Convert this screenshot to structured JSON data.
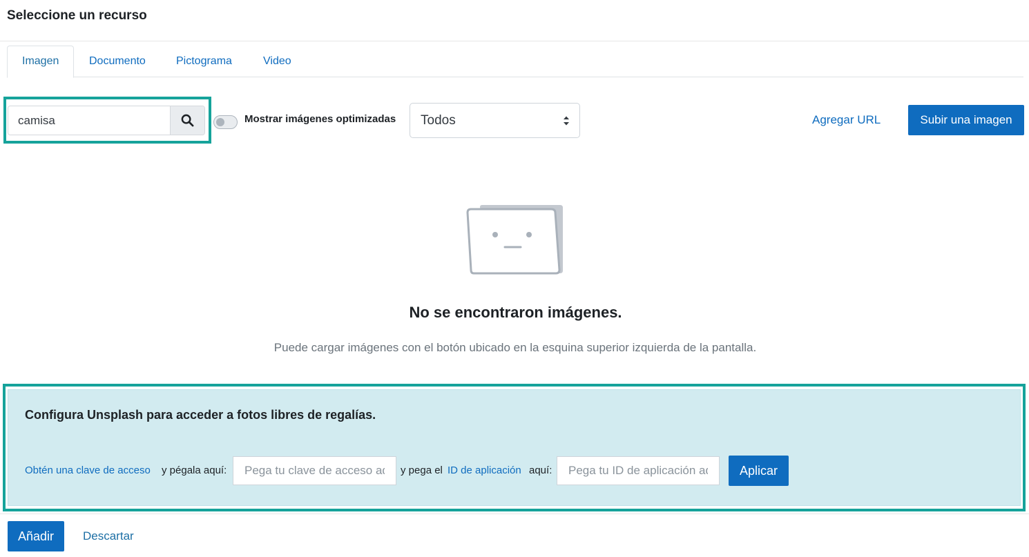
{
  "dialog": {
    "title": "Seleccione un recurso"
  },
  "tabs": [
    {
      "label": "Imagen",
      "active": true
    },
    {
      "label": "Documento",
      "active": false
    },
    {
      "label": "Pictograma",
      "active": false
    },
    {
      "label": "Video",
      "active": false
    }
  ],
  "toolbar": {
    "search_value": "camisa",
    "toggle_label": "Mostrar imágenes optimizadas",
    "toggle_on": false,
    "filter_selected": "Todos",
    "add_url_label": "Agregar URL",
    "upload_label": "Subir una imagen"
  },
  "empty_state": {
    "title": "No se encontraron imágenes.",
    "message": "Puede cargar imágenes con el botón ubicado en la esquina superior izquierda de la pantalla."
  },
  "unsplash": {
    "title": "Configura Unsplash para acceder a fotos libres de regalías.",
    "access_key_link": "Obtén una clave de acceso",
    "text_paste_here": "y pégala aquí:",
    "access_key_placeholder": "Pega tu clave de acceso aquí",
    "text_and_paste": "y pega el",
    "app_id_link": "ID de aplicación",
    "text_here": "aquí:",
    "app_id_placeholder": "Pega tu ID de aplicación aquí",
    "apply_label": "Aplicar"
  },
  "footer": {
    "add_label": "Añadir",
    "discard_label": "Descartar"
  },
  "colors": {
    "primary": "#0f6cbf",
    "highlight": "#16a39b",
    "info_panel": "#d2ebf0"
  }
}
